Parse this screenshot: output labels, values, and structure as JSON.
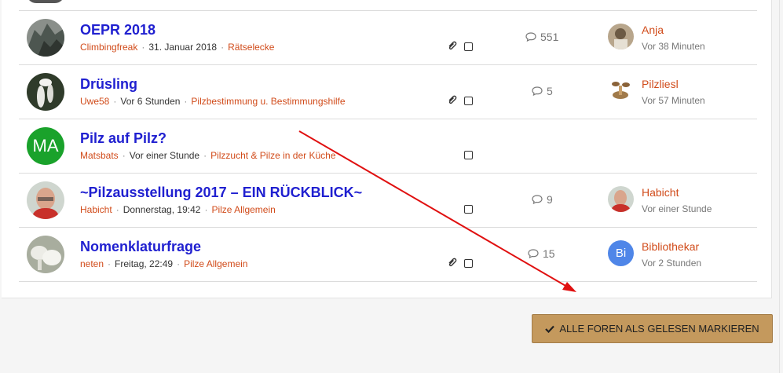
{
  "threads": [
    {
      "title": "OEPR 2018",
      "author": "Climbingfreak",
      "date": "31. Januar 2018",
      "forum": "Rätselecke",
      "replies": "551",
      "last_user": "Anja",
      "last_time": "Vor 38 Minuten",
      "has_attachment": true
    },
    {
      "title": "Drüsling",
      "author": "Uwe58",
      "date": "Vor 6 Stunden",
      "forum": "Pilzbestimmung u. Bestimmungshilfe",
      "replies": "5",
      "last_user": "Pilzliesl",
      "last_time": "Vor 57 Minuten",
      "has_attachment": true
    },
    {
      "title": "Pilz auf Pilz?",
      "author": "Matsbats",
      "date": "Vor einer Stunde",
      "forum": "Pilzzucht & Pilze in der Küche",
      "avatar_letters": "MA",
      "has_attachment": false
    },
    {
      "title": "~Pilzausstellung 2017 – EIN RÜCKBLICK~",
      "author": "Habicht",
      "date": "Donnerstag, 19:42",
      "forum": "Pilze Allgemein",
      "replies": "9",
      "last_user": "Habicht",
      "last_time": "Vor einer Stunde",
      "has_attachment": false
    },
    {
      "title": "Nomenklaturfrage",
      "author": "neten",
      "date": "Freitag, 22:49",
      "forum": "Pilze Allgemein",
      "replies": "15",
      "last_user": "Bibliothekar",
      "last_time": "Vor 2 Stunden",
      "last_avatar_letters": "Bi",
      "has_attachment": true
    }
  ],
  "mark_all_read": "ALLE FOREN ALS GELESEN MARKIEREN",
  "colors": {
    "link": "#2020d0",
    "user": "#d14b1a",
    "button": "#c4995d",
    "arrow": "#e01010"
  }
}
